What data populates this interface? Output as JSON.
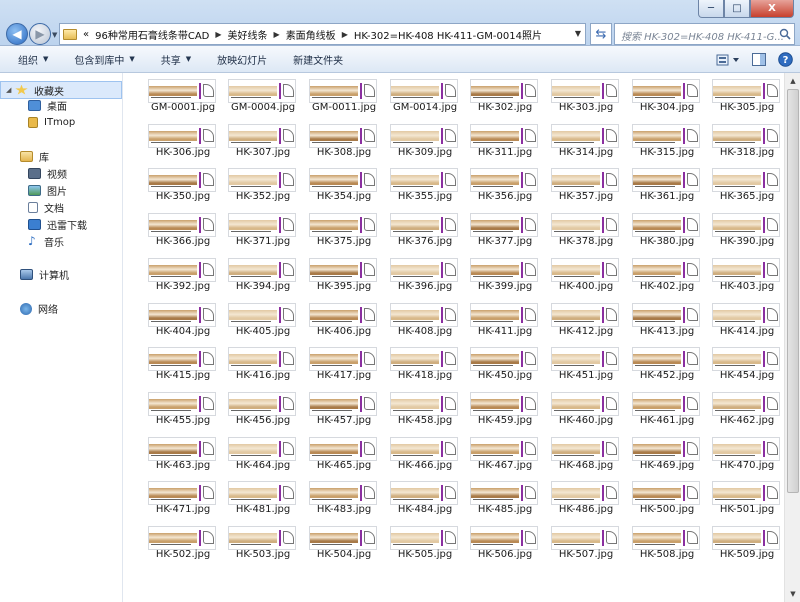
{
  "window": {
    "minimize_glyph": "─",
    "maximize_glyph": "□",
    "close_glyph": "X"
  },
  "address_bar": {
    "overflow_glyph": "«",
    "breadcrumbs": [
      "96种常用石膏线条带CAD",
      "美好线条",
      "素面角线板",
      "HK-302=HK-408  HK-411-GM-0014照片"
    ]
  },
  "search": {
    "placeholder": "搜索 HK-302=HK-408  HK-411-G..."
  },
  "command_bar": {
    "organize": "组织",
    "include_in_library": "包含到库中",
    "share": "共享",
    "slideshow": "放映幻灯片",
    "new_folder": "新建文件夹"
  },
  "sidebar": {
    "favorites": "收藏夹",
    "desktop": "桌面",
    "itmop": "ITmop",
    "libraries": "库",
    "videos": "视频",
    "pictures": "图片",
    "documents": "文档",
    "thunder": "迅雷下载",
    "music": "音乐",
    "computer": "计算机",
    "network": "网络"
  },
  "files": [
    "GM-0001.jpg",
    "GM-0004.jpg",
    "GM-0011.jpg",
    "GM-0014.jpg",
    "HK-302.jpg",
    "HK-303.jpg",
    "HK-304.jpg",
    "HK-305.jpg",
    "HK-306.jpg",
    "HK-307.jpg",
    "HK-308.jpg",
    "HK-309.jpg",
    "HK-311.jpg",
    "HK-314.jpg",
    "HK-315.jpg",
    "HK-318.jpg",
    "HK-350.jpg",
    "HK-352.jpg",
    "HK-354.jpg",
    "HK-355.jpg",
    "HK-356.jpg",
    "HK-357.jpg",
    "HK-361.jpg",
    "HK-365.jpg",
    "HK-366.jpg",
    "HK-371.jpg",
    "HK-375.jpg",
    "HK-376.jpg",
    "HK-377.jpg",
    "HK-378.jpg",
    "HK-380.jpg",
    "HK-390.jpg",
    "HK-392.jpg",
    "HK-394.jpg",
    "HK-395.jpg",
    "HK-396.jpg",
    "HK-399.jpg",
    "HK-400.jpg",
    "HK-402.jpg",
    "HK-403.jpg",
    "HK-404.jpg",
    "HK-405.jpg",
    "HK-406.jpg",
    "HK-408.jpg",
    "HK-411.jpg",
    "HK-412.jpg",
    "HK-413.jpg",
    "HK-414.jpg",
    "HK-415.jpg",
    "HK-416.jpg",
    "HK-417.jpg",
    "HK-418.jpg",
    "HK-450.jpg",
    "HK-451.jpg",
    "HK-452.jpg",
    "HK-454.jpg",
    "HK-455.jpg",
    "HK-456.jpg",
    "HK-457.jpg",
    "HK-458.jpg",
    "HK-459.jpg",
    "HK-460.jpg",
    "HK-461.jpg",
    "HK-462.jpg",
    "HK-463.jpg",
    "HK-464.jpg",
    "HK-465.jpg",
    "HK-466.jpg",
    "HK-467.jpg",
    "HK-468.jpg",
    "HK-469.jpg",
    "HK-470.jpg",
    "HK-471.jpg",
    "HK-481.jpg",
    "HK-483.jpg",
    "HK-484.jpg",
    "HK-485.jpg",
    "HK-486.jpg",
    "HK-500.jpg",
    "HK-501.jpg",
    "HK-502.jpg",
    "HK-503.jpg",
    "HK-504.jpg",
    "HK-505.jpg",
    "HK-506.jpg",
    "HK-507.jpg",
    "HK-508.jpg",
    "HK-509.jpg"
  ],
  "colors": {
    "moulding_tones": [
      "#c9a06b",
      "#d8b98a",
      "#b98a55",
      "#e2c9a3",
      "#a87a48",
      "#cfae7f"
    ]
  }
}
